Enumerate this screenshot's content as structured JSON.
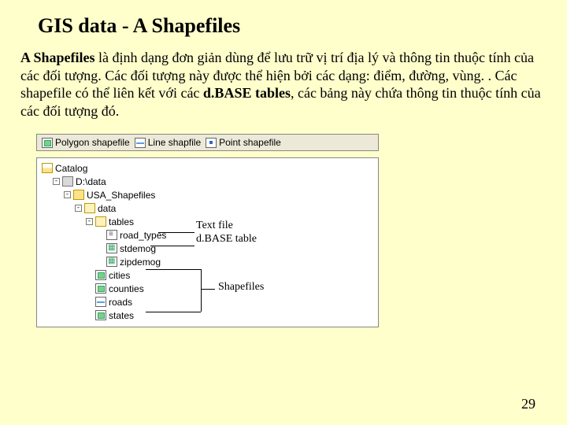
{
  "title": "GIS data - A Shapefiles",
  "para": {
    "lead": "A Shapefiles",
    "p1": " là định dạng đơn giản dùng để lưu trữ vị trí địa lý và thông tin thuộc tính của các đối tượng. Các đối tượng này được thể hiện bởi các dạng: điểm, đường, vùng. . Các shapefile có thể liên kết với các ",
    "bold2": "d.BASE tables",
    "p2": ", các bảng này chứa thông tin thuộc tính của các đối tượng đó."
  },
  "topbar": {
    "poly": "Polygon shapefile",
    "line": "Line shapfile",
    "point": "Point shapefile"
  },
  "tree": {
    "catalog": "Catalog",
    "drive": "D:\\data",
    "folder1": "USA_Shapefiles",
    "folder2": "data",
    "folder3": "tables",
    "txt": "road_types",
    "dbf": "stdemog",
    "zip": "zipdemog",
    "poly1": "cities",
    "poly2": "counties",
    "line1": "roads",
    "poly3": "states"
  },
  "annot": {
    "txt": "Text file",
    "dbase": "d.BASE table",
    "shp": "Shapefiles"
  },
  "page": "29"
}
